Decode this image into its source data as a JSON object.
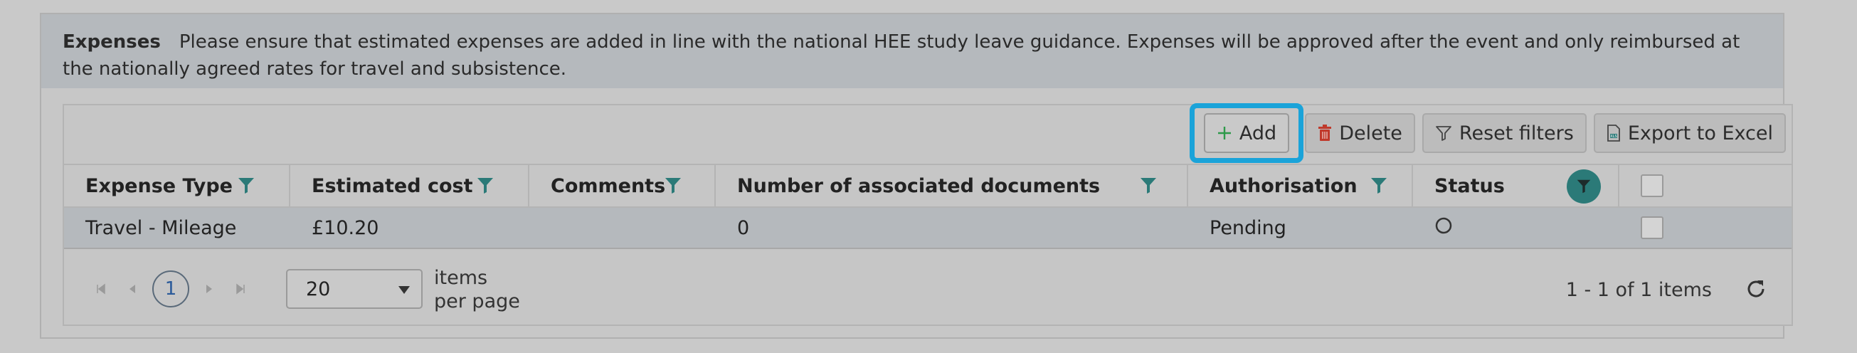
{
  "banner": {
    "title": "Expenses",
    "text": "Please ensure that estimated expenses are added in line with the national HEE study leave guidance. Expenses will be approved after the event and only reimbursed at the nationally agreed rates for travel and subsistence."
  },
  "toolbar": {
    "add_label": "Add",
    "delete_label": "Delete",
    "reset_label": "Reset filters",
    "export_label": "Export to Excel"
  },
  "columns": [
    "Expense Type",
    "Estimated cost",
    "Comments",
    "Number of associated documents",
    "Authorisation",
    "Status"
  ],
  "rows": [
    {
      "expense_type": "Travel - Mileage",
      "estimated_cost": "£10.20",
      "comments": "",
      "documents": "0",
      "authorisation": "Pending"
    }
  ],
  "pager": {
    "current_page": "1",
    "page_size": "20",
    "items_per_page_line1": "items",
    "items_per_page_line2": "per page",
    "info": "1 - 1 of 1 items"
  },
  "icons": {
    "filter": "filter-icon",
    "add": "plus-icon",
    "delete": "trash-icon",
    "reset": "filter-outline-icon",
    "export": "excel-icon",
    "refresh": "refresh-icon",
    "status": "circle-icon"
  },
  "colors": {
    "highlight": "#1aa3d9",
    "filter_accent": "#2b7a78",
    "delete_icon": "#c0392b"
  }
}
